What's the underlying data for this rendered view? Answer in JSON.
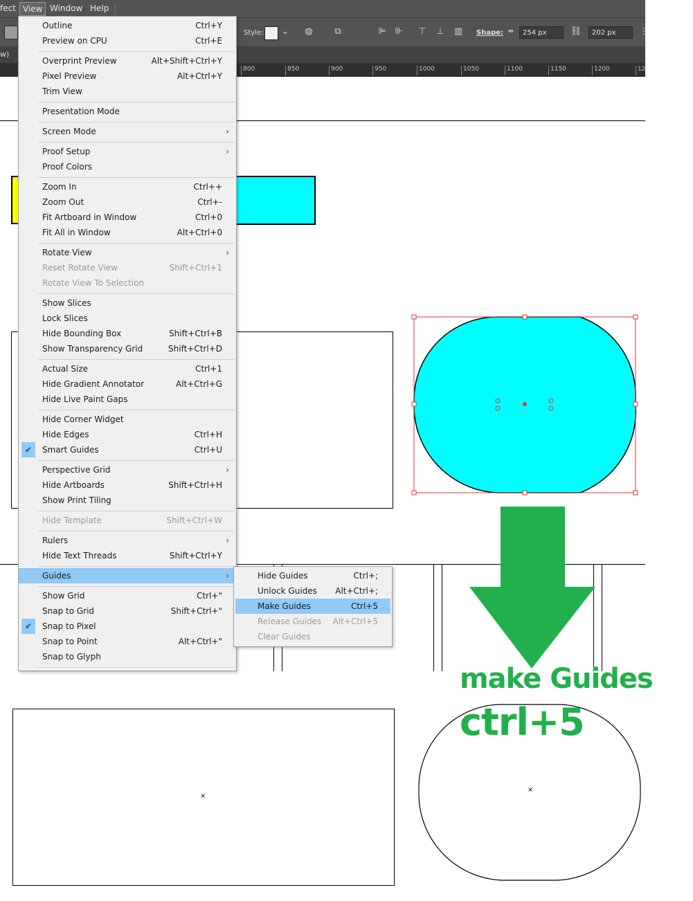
{
  "menubar": {
    "items": [
      "fect",
      "View",
      "Window",
      "Help"
    ]
  },
  "toolbar": {
    "style_label": "Style:",
    "shape_label": "Shape:",
    "width_value": "254 px",
    "height_value": "202 px",
    "left_edge_label": "w)"
  },
  "ruler": {
    "ticks": [
      "800",
      "850",
      "900",
      "950",
      "1000",
      "1050",
      "1100",
      "1150",
      "1200",
      "12"
    ]
  },
  "view_menu": {
    "items": [
      {
        "label": "Outline",
        "shortcut": "Ctrl+Y"
      },
      {
        "label": "Preview on CPU",
        "shortcut": "Ctrl+E"
      },
      {
        "label": "Overprint Preview",
        "shortcut": "Alt+Shift+Ctrl+Y"
      },
      {
        "label": "Pixel Preview",
        "shortcut": "Alt+Ctrl+Y"
      },
      {
        "label": "Trim View",
        "shortcut": ""
      },
      {
        "label": "Presentation Mode",
        "shortcut": ""
      },
      {
        "label": "Screen Mode",
        "shortcut": ""
      },
      {
        "label": "Proof Setup",
        "shortcut": ""
      },
      {
        "label": "Proof Colors",
        "shortcut": ""
      },
      {
        "label": "Zoom In",
        "shortcut": "Ctrl++"
      },
      {
        "label": "Zoom Out",
        "shortcut": "Ctrl+-"
      },
      {
        "label": "Fit Artboard in Window",
        "shortcut": "Ctrl+0"
      },
      {
        "label": "Fit All in Window",
        "shortcut": "Alt+Ctrl+0"
      },
      {
        "label": "Rotate View",
        "shortcut": ""
      },
      {
        "label": "Reset Rotate View",
        "shortcut": "Shift+Ctrl+1"
      },
      {
        "label": "Rotate View To Selection",
        "shortcut": ""
      },
      {
        "label": "Show Slices",
        "shortcut": ""
      },
      {
        "label": "Lock Slices",
        "shortcut": ""
      },
      {
        "label": "Hide Bounding Box",
        "shortcut": "Shift+Ctrl+B"
      },
      {
        "label": "Show Transparency Grid",
        "shortcut": "Shift+Ctrl+D"
      },
      {
        "label": "Actual Size",
        "shortcut": "Ctrl+1"
      },
      {
        "label": "Hide Gradient Annotator",
        "shortcut": "Alt+Ctrl+G"
      },
      {
        "label": "Hide Live Paint Gaps",
        "shortcut": ""
      },
      {
        "label": "Hide Corner Widget",
        "shortcut": ""
      },
      {
        "label": "Hide Edges",
        "shortcut": "Ctrl+H"
      },
      {
        "label": "Smart Guides",
        "shortcut": "Ctrl+U"
      },
      {
        "label": "Perspective Grid",
        "shortcut": ""
      },
      {
        "label": "Hide Artboards",
        "shortcut": "Shift+Ctrl+H"
      },
      {
        "label": "Show Print Tiling",
        "shortcut": ""
      },
      {
        "label": "Hide Template",
        "shortcut": "Shift+Ctrl+W"
      },
      {
        "label": "Rulers",
        "shortcut": ""
      },
      {
        "label": "Hide Text Threads",
        "shortcut": "Shift+Ctrl+Y"
      },
      {
        "label": "Guides",
        "shortcut": ""
      },
      {
        "label": "Show Grid",
        "shortcut": "Ctrl+\""
      },
      {
        "label": "Snap to Grid",
        "shortcut": "Shift+Ctrl+\""
      },
      {
        "label": "Snap to Pixel",
        "shortcut": ""
      },
      {
        "label": "Snap to Point",
        "shortcut": "Alt+Ctrl+\""
      },
      {
        "label": "Snap to Glyph",
        "shortcut": ""
      }
    ]
  },
  "guides_submenu": {
    "items": [
      {
        "label": "Hide Guides",
        "shortcut": "Ctrl+;"
      },
      {
        "label": "Unlock Guides",
        "shortcut": "Alt+Ctrl+;"
      },
      {
        "label": "Make Guides",
        "shortcut": "Ctrl+5"
      },
      {
        "label": "Release Guides",
        "shortcut": "Alt+Ctrl+5"
      },
      {
        "label": "Clear Guides",
        "shortcut": ""
      }
    ]
  },
  "annotation": {
    "line1": "make Guides",
    "line2": "ctrl+5",
    "color": "#21b04b"
  },
  "colors": {
    "cyan_fill": "#00ffff",
    "yellow_fill": "#ffff00",
    "selection": "#e0303a",
    "menu_highlight": "#91c9f7"
  }
}
